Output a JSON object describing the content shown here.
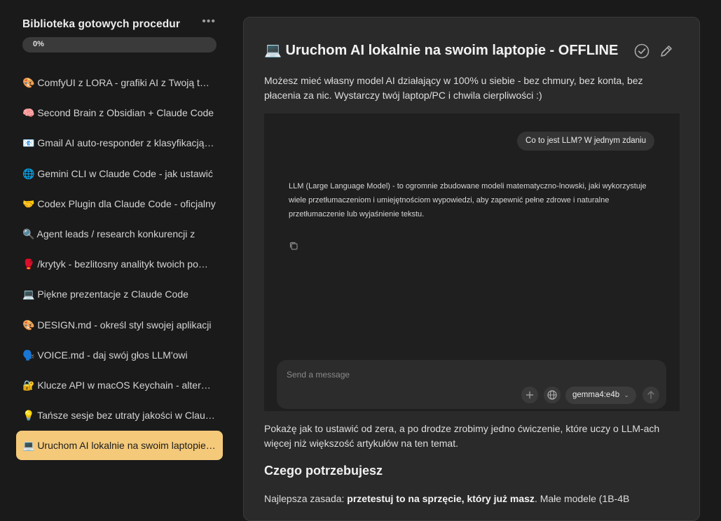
{
  "sidebar": {
    "title": "Biblioteka gotowych procedur",
    "menu_label": "•••",
    "progress_label": "0%",
    "progress_value": 0,
    "items": [
      {
        "label": "🎨 ComfyUI z LORA - grafiki AI z Twoją twarzą"
      },
      {
        "label": "🧠 Second Brain z Obsidian + Claude Code"
      },
      {
        "label": "📧 Gmail AI auto-responder z klasyfikacją maili"
      },
      {
        "label": "🌐 Gemini CLI w Claude Code - jak ustawić"
      },
      {
        "label": "🤝 Codex Plugin dla Claude Code - oficjalny"
      },
      {
        "label": "🔍 Agent leads / research konkurencji z"
      },
      {
        "label": "🥊 /krytyk - bezlitosny analityk twoich pomysłów"
      },
      {
        "label": "💻 Piękne prezentacje z Claude Code"
      },
      {
        "label": "🎨 DESIGN.md - określ styl swojej aplikacji"
      },
      {
        "label": "🗣️ VOICE.md - daj swój głos LLM'owi"
      },
      {
        "label": "🔐 Klucze API w macOS Keychain - alternatywa"
      },
      {
        "label": "💡 Tańsze sesje bez utraty jakości w Claude Code"
      },
      {
        "label": "💻 Uruchom AI lokalnie na swoim laptopie - OFFLINE",
        "active": true
      }
    ]
  },
  "main": {
    "title": "💻 Uruchom AI lokalnie na swoim laptopie - OFFLINE",
    "intro": "Możesz mieć własny model AI działający w 100% u siebie - bez chmury, bez konta, bez płacenia za nic. Wystarczy twój laptop/PC i chwila cierpliwości :)",
    "screenshot": {
      "question": "Co to jest LLM? W jednym zdaniu",
      "answer": "LLM (Large Language Model) - to ogromnie zbudowane modeli matematyczno-lnowski, jaki wykorzystuje wiele przetłumaczeniom i umiejętnościom wypowiedzi, aby zapewnić pełne zdrowe i naturalne przetłumaczenie lub wyjaśnienie tekstu.",
      "composer_placeholder": "Send a message",
      "model": "gemma4:e4b"
    },
    "after_text": "Pokażę jak to ustawić od zera, a po drodze zrobimy jedno ćwiczenie, które uczy o LLM-ach więcej niż większość artykułów na ten temat.",
    "section_heading": "Czego potrzebujesz",
    "section_lead": "Najlepsza zasada: ",
    "section_bold": "przetestuj to na sprzęcie, który już masz",
    "section_rest": ". Małe modele (1B-4B"
  }
}
